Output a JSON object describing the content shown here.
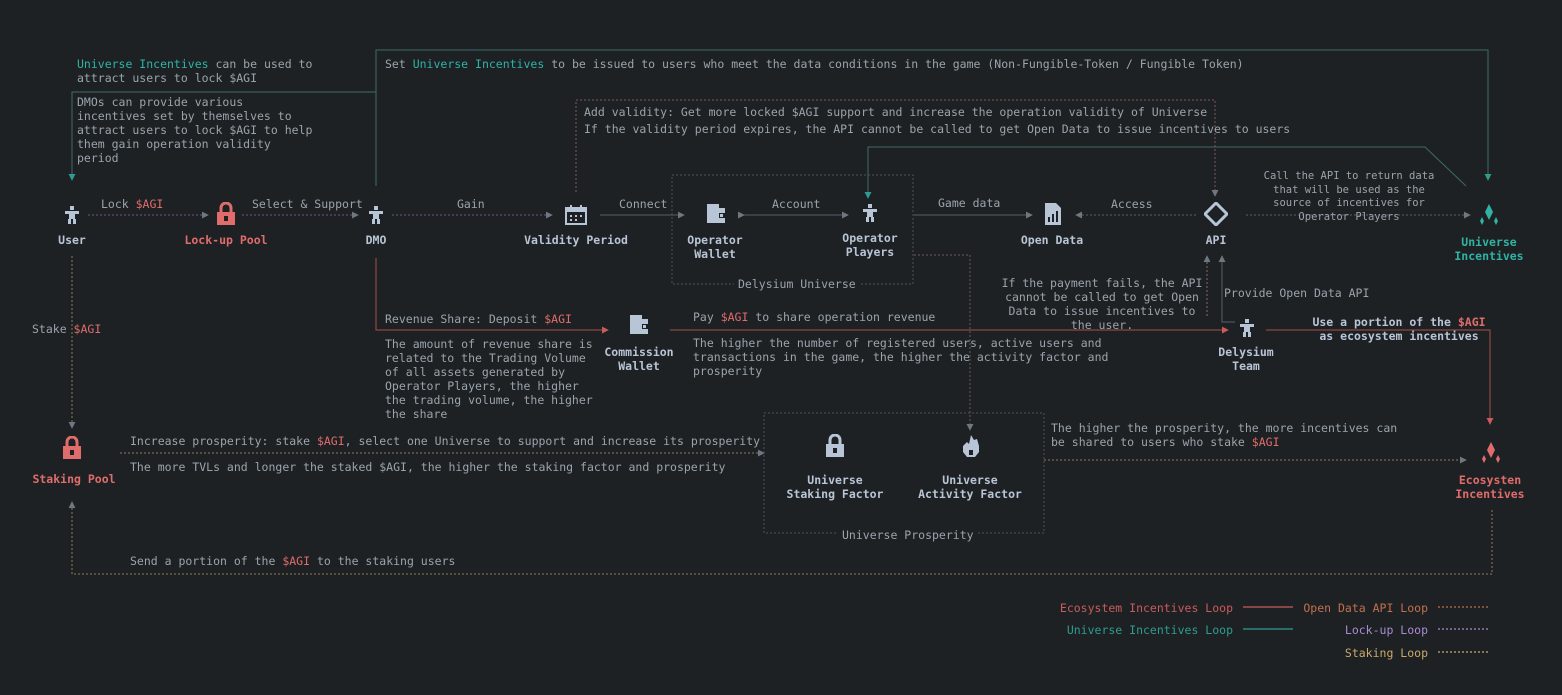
{
  "nodes": {
    "user": "User",
    "lockup_pool": "Lock-up Pool",
    "dmo": "DMO",
    "validity_period": "Validity Period",
    "operator_wallet": "Operator Wallet",
    "operator_players": "Operator Players",
    "delysium_universe": "Delysium Universe",
    "open_data": "Open Data",
    "api": "API",
    "universe_incentives": "Universe Incentives",
    "commission_wallet": "Commission Wallet",
    "delysium_team": "Delysium Team",
    "staking_pool": "Staking Pool",
    "universe_staking_factor": "Universe Staking Factor",
    "universe_activity_factor": "Universe Activity Factor",
    "universe_prosperity": "Universe Prosperity",
    "ecosystem_incentives": "Ecosysten Incentives"
  },
  "edges": {
    "lock": {
      "text": "Lock ",
      "agi": "$AGI"
    },
    "select_support": "Select & Support",
    "gain": "Gain",
    "connect": "Connect",
    "account": "Account",
    "game_data": "Game data",
    "access": "Access",
    "stake": {
      "text": "Stake ",
      "agi": "$AGI"
    },
    "provide_open_data_api": "Provide Open Data API"
  },
  "notes": {
    "top_left": {
      "hl": "Universe Incentives",
      "rest": " can be used to attract users to lock $AGI"
    },
    "dmo_incentives": "DMOs can provide various incentives set by themselves to attract users to lock $AGI to help them gain operation validity period",
    "set_incentives": {
      "pre": "Set ",
      "hl": "Universe Incentives",
      "post": " to be issued to users who meet the data conditions in the game (Non-Fungible-Token / Fungible Token)"
    },
    "add_validity": "Add validity: Get more locked $AGI support and increase the operation validity of Universe",
    "validity_expires": "If the validity period expires, the API cannot be called to get Open Data to issue incentives to users",
    "call_api": "Call the API to return data that will be used as the source of incentives for Operator Players",
    "payment_fails": "If the payment fails, the API cannot be called to get Open Data to issue incentives to the user.",
    "revenue_share": {
      "text": "Revenue Share: Deposit ",
      "agi": "$AGI"
    },
    "revenue_share_detail": "The amount of revenue share is related to the Trading Volume of all assets generated by Operator Players, the higher the trading volume, the higher the share",
    "pay": {
      "pre": "Pay ",
      "agi": "$AGI",
      "post": " to share operation revenue"
    },
    "activity_detail": "The higher the number of registered users, active users and transactions in the game, the higher the activity factor and prosperity",
    "use_portion": {
      "pre": "Use a portion of the ",
      "agi": "$AGI",
      "post": " as ecosystem incentives"
    },
    "increase_prosperity": {
      "pre": "Increase prosperity: stake ",
      "agi": "$AGI",
      "post": ", select one Universe to support and increase its prosperity"
    },
    "more_tvls": "The more TVLs and longer the staked $AGI, the higher the staking factor and prosperity",
    "higher_prosperity": {
      "pre": "The higher the prosperity, the more incentives can be shared to users who stake ",
      "agi": "$AGI"
    },
    "send_portion": {
      "pre": "Send a portion of the ",
      "agi": "$AGI",
      "post": " to the staking users"
    }
  },
  "legend": {
    "ecosystem": "Ecosystem Incentives Loop",
    "open_data_api": "Open Data API Loop",
    "universe": "Universe Incentives Loop",
    "lockup": "Lock-up Loop",
    "staking": "Staking Loop"
  },
  "colors": {
    "background": "#1e2123",
    "node": "#b8c5d6",
    "red": "#e06c6c",
    "teal": "#2fb3a3",
    "purple": "#a98bd6",
    "yellow": "#c9a86a",
    "orange": "#c0704d"
  }
}
